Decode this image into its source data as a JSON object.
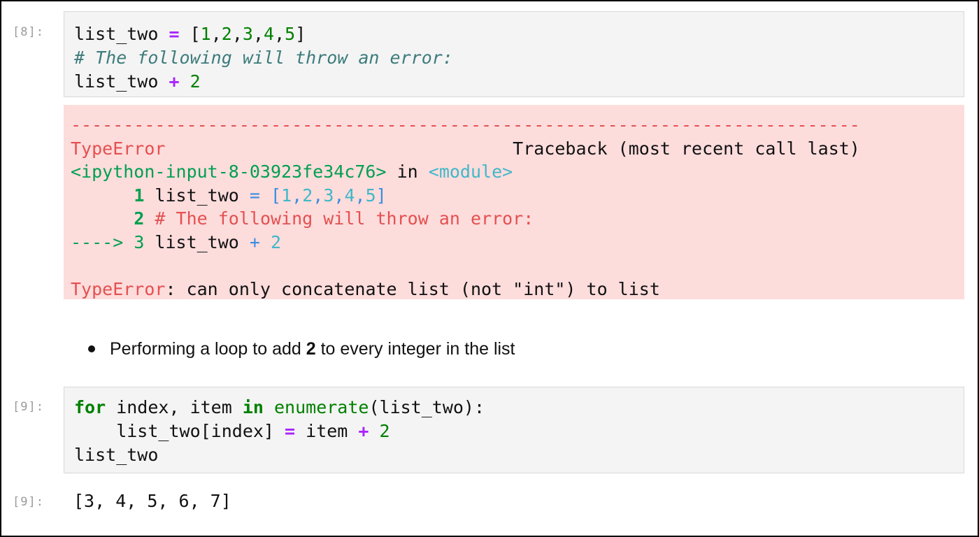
{
  "cells": [
    {
      "prompt": "[8]:",
      "code": [
        [
          {
            "t": "list_two ",
            "c": ""
          },
          {
            "t": "=",
            "c": "kw-op"
          },
          {
            "t": " [",
            "c": ""
          },
          {
            "t": "1",
            "c": "num"
          },
          {
            "t": ",",
            "c": ""
          },
          {
            "t": "2",
            "c": "num"
          },
          {
            "t": ",",
            "c": ""
          },
          {
            "t": "3",
            "c": "num"
          },
          {
            "t": ",",
            "c": ""
          },
          {
            "t": "4",
            "c": "num"
          },
          {
            "t": ",",
            "c": ""
          },
          {
            "t": "5",
            "c": "num"
          },
          {
            "t": "]",
            "c": ""
          }
        ],
        [
          {
            "t": "# The following will throw an error:",
            "c": "comment"
          }
        ],
        [
          {
            "t": "list_two ",
            "c": ""
          },
          {
            "t": "+",
            "c": "kw-op"
          },
          {
            "t": " ",
            "c": ""
          },
          {
            "t": "2",
            "c": "num"
          }
        ]
      ]
    },
    {
      "prompt": "[9]:",
      "code": [
        [
          {
            "t": "for",
            "c": "kw"
          },
          {
            "t": " index, item ",
            "c": ""
          },
          {
            "t": "in",
            "c": "kw"
          },
          {
            "t": " ",
            "c": ""
          },
          {
            "t": "enumerate",
            "c": "builtin"
          },
          {
            "t": "(list_two):",
            "c": ""
          }
        ],
        [
          {
            "t": "    list_two[index] ",
            "c": ""
          },
          {
            "t": "=",
            "c": "kw-op"
          },
          {
            "t": " item ",
            "c": ""
          },
          {
            "t": "+",
            "c": "kw-op"
          },
          {
            "t": " ",
            "c": ""
          },
          {
            "t": "2",
            "c": "num"
          }
        ],
        [
          {
            "t": "list_two",
            "c": ""
          }
        ]
      ]
    }
  ],
  "traceback": [
    [
      {
        "t": "---------------------------------------------------------------------------",
        "c": "red"
      }
    ],
    [
      {
        "t": "TypeError",
        "c": "red"
      },
      {
        "t": "                                 Traceback (most recent call last)",
        "c": ""
      }
    ],
    [
      {
        "t": "<ipython-input-8-03923fe34c76>",
        "c": "green"
      },
      {
        "t": " in ",
        "c": ""
      },
      {
        "t": "<module>",
        "c": "cyan"
      }
    ],
    [
      {
        "t": "      ",
        "c": ""
      },
      {
        "t": "1",
        "c": "bold-green"
      },
      {
        "t": " list_two ",
        "c": ""
      },
      {
        "t": "=",
        "c": "blue"
      },
      {
        "t": " [",
        "c": "blue"
      },
      {
        "t": "1",
        "c": "cyan"
      },
      {
        "t": ",",
        "c": "blue"
      },
      {
        "t": "2",
        "c": "cyan"
      },
      {
        "t": ",",
        "c": "blue"
      },
      {
        "t": "3",
        "c": "cyan"
      },
      {
        "t": ",",
        "c": "blue"
      },
      {
        "t": "4",
        "c": "cyan"
      },
      {
        "t": ",",
        "c": "blue"
      },
      {
        "t": "5",
        "c": "cyan"
      },
      {
        "t": "]",
        "c": "blue"
      }
    ],
    [
      {
        "t": "      ",
        "c": ""
      },
      {
        "t": "2",
        "c": "bold-green"
      },
      {
        "t": " # The following will throw an error:",
        "c": "red"
      }
    ],
    [
      {
        "t": "---->",
        "c": "green"
      },
      {
        "t": " 3",
        "c": "green"
      },
      {
        "t": " list_two ",
        "c": ""
      },
      {
        "t": "+",
        "c": "blue"
      },
      {
        "t": " ",
        "c": ""
      },
      {
        "t": "2",
        "c": "cyan"
      }
    ],
    [
      {
        "t": "",
        "c": ""
      }
    ],
    [
      {
        "t": "TypeError",
        "c": "red"
      },
      {
        "t": ": can only concatenate list (not \"int\") to list",
        "c": ""
      }
    ]
  ],
  "markdown": {
    "before": "Performing a loop to add ",
    "bold": "2",
    "after": " to every integer in the list"
  },
  "output": {
    "prompt": "[9]:",
    "text": "[3, 4, 5, 6, 7]"
  }
}
